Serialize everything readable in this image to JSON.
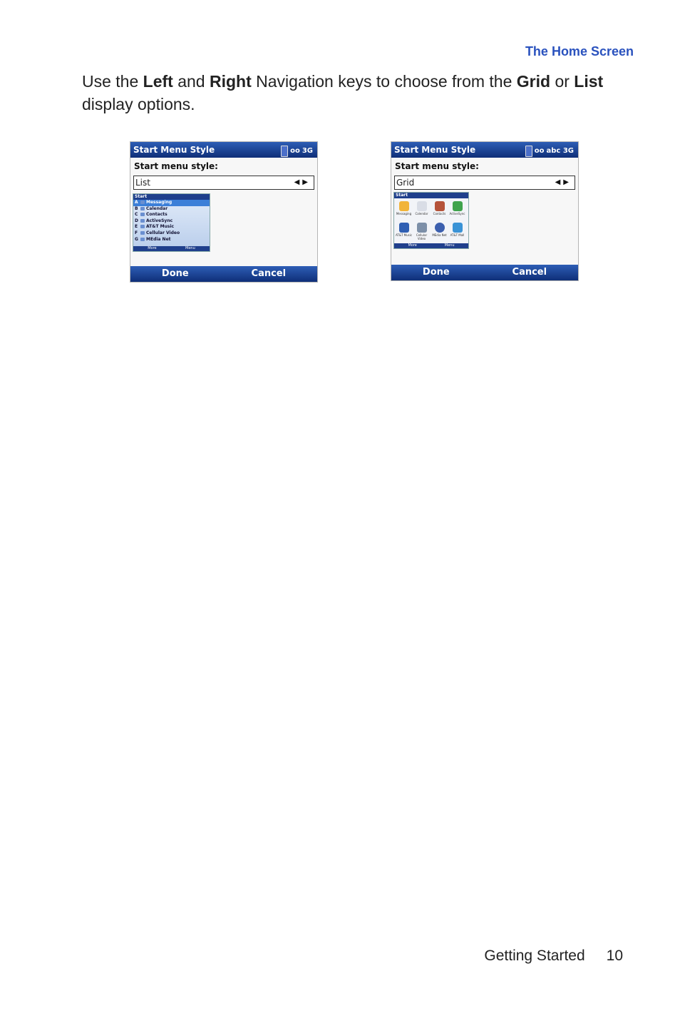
{
  "header": "The Home Screen",
  "intro": {
    "p1": "Use the ",
    "b1": "Left",
    "p2": " and ",
    "b2": "Right",
    "p3": " Navigation keys to choose from the ",
    "b3": "Grid",
    "p4": " or ",
    "b4": "List",
    "p5": " display options."
  },
  "screens": [
    {
      "title": "Start Menu Style",
      "status": "3G",
      "label": "Start menu style:",
      "value": "List",
      "mini_title": "Start",
      "list": [
        {
          "key": "A",
          "label": "Messaging"
        },
        {
          "key": "B",
          "label": "Calendar"
        },
        {
          "key": "C",
          "label": "Contacts"
        },
        {
          "key": "D",
          "label": "ActiveSync"
        },
        {
          "key": "E",
          "label": "AT&T Music"
        },
        {
          "key": "F",
          "label": "Cellular Video"
        },
        {
          "key": "G",
          "label": "MEdia Net"
        }
      ],
      "mini_soft": [
        "More",
        "Menu"
      ],
      "soft_left": "Done",
      "soft_right": "Cancel"
    },
    {
      "title": "Start Menu Style",
      "status": "abc 3G",
      "label": "Start menu style:",
      "value": "Grid",
      "mini_title": "Start",
      "grid": [
        "Messaging",
        "Calendar",
        "Contacts",
        "ActiveSync",
        "AT&T Music",
        "Cellular Video",
        "MEdia Net",
        "AT&T Mall"
      ],
      "mini_soft": [
        "More",
        "Menu"
      ],
      "soft_left": "Done",
      "soft_right": "Cancel"
    }
  ],
  "footer": {
    "section": "Getting Started",
    "page": "10"
  }
}
